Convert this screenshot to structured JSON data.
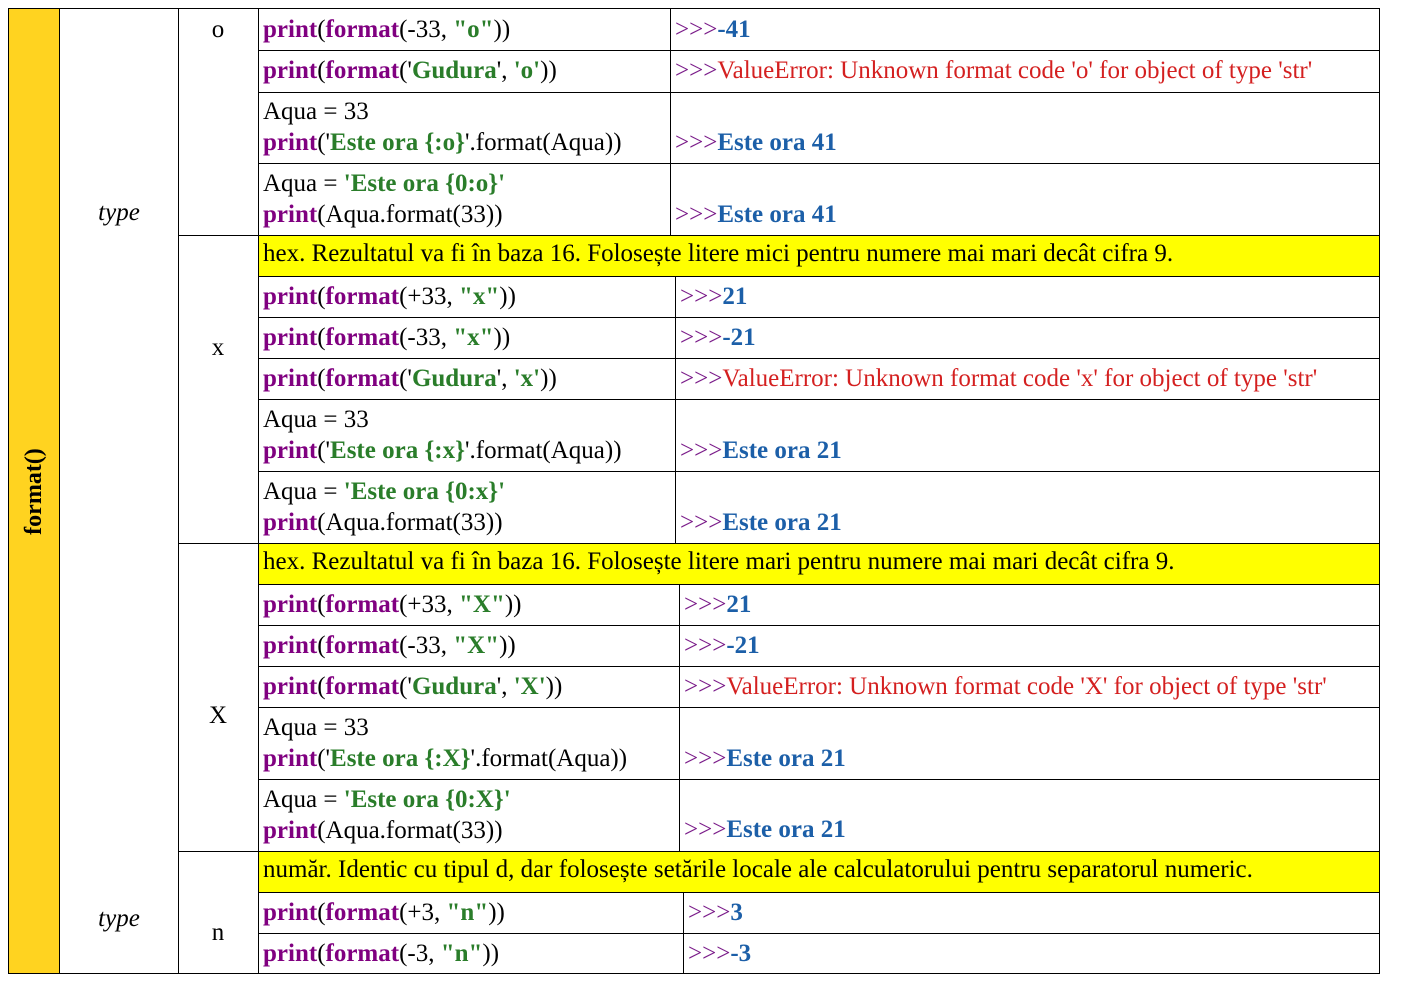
{
  "side_label": "format()",
  "type_label_top": "type",
  "type_label_bottom": "type",
  "specs": {
    "o": "o",
    "x": "x",
    "X": "X",
    "n": "n"
  },
  "headers": {
    "x": "hex. Rezultatul va fi în baza 16. Folosește litere mici pentru numere mai mari decât cifra 9.",
    "X": "hex. Rezultatul va fi în baza 16. Folosește litere mari pentru numere mai mari decât cifra 9.",
    "n": "număr. Identic cu tipul d, dar folosește setările locale ale calculatorului pentru separatorul numeric."
  },
  "tokens": {
    "print": "print",
    "format": "format",
    "aqua33": "Aqua = 33",
    "aqua_eq": "Aqua = ",
    "prompt": ">>>",
    "lpar": "(",
    "rpar": ")",
    "rpar2": "))",
    "quote": "'",
    "comma": ", ",
    "dotformat": ".format(Aqua))",
    "aquaformat": "(Aqua.format(33))",
    "gudura": "Gudura"
  },
  "o": {
    "r1": {
      "arg": "-33, ",
      "fmt": "\"o\"",
      "res": "-41"
    },
    "r2": {
      "fmt": "'o'",
      "res": "ValueError: Unknown format code 'o' for object of type 'str'"
    },
    "r3": {
      "str": "Este ora {:o}",
      "res": "Este ora 41"
    },
    "r4": {
      "str": "'Este ora {0:o}'",
      "res": "Este ora 41"
    }
  },
  "x": {
    "r1": {
      "arg": "+33, ",
      "fmt": "\"x\"",
      "res": "21"
    },
    "r2": {
      "arg": "-33, ",
      "fmt": "\"x\"",
      "res": "-21"
    },
    "r3": {
      "fmt": "'x'",
      "res": "ValueError: Unknown format code 'x' for object of type 'str'"
    },
    "r4": {
      "str": "Este ora {:x}",
      "res": "Este ora 21"
    },
    "r5": {
      "str": "'Este ora {0:x}'",
      "res": "Este ora 21"
    }
  },
  "X": {
    "r1": {
      "arg": "+33, ",
      "fmt": "\"X\"",
      "res": "21"
    },
    "r2": {
      "arg": "-33, ",
      "fmt": "\"X\"",
      "res": "-21"
    },
    "r3": {
      "fmt": "'X'",
      "res": "ValueError: Unknown format code 'X' for object of type 'str'"
    },
    "r4": {
      "str": "Este ora {:X}",
      "res": "Este ora 21"
    },
    "r5": {
      "str": "'Este ora {0:X}'",
      "res": "Este ora 21"
    }
  },
  "n": {
    "r1": {
      "arg": "+3, ",
      "fmt": "\"n\"",
      "res": "3"
    },
    "r2": {
      "arg": "-3, ",
      "fmt": "\"n\"",
      "res": "-3"
    }
  },
  "colors": {
    "side": "#ffd320",
    "header": "#ffff00",
    "keyword": "#800080",
    "string": "#2a7d2a",
    "result": "#1c5fa8",
    "error": "#d42020"
  }
}
